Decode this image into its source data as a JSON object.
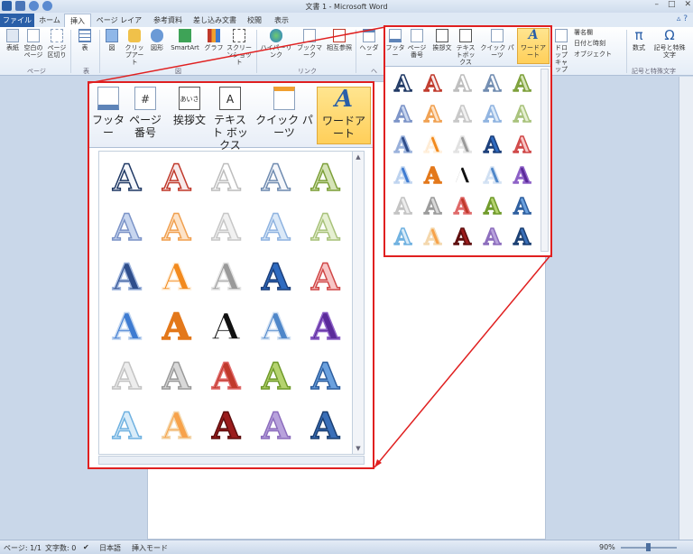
{
  "window": {
    "title": "文書 1 - Microsoft Word"
  },
  "tabs": [
    {
      "label": "ファイル"
    },
    {
      "label": "ホーム"
    },
    {
      "label": "挿入"
    },
    {
      "label": "ページ レイアウト"
    },
    {
      "label": "参考資料"
    },
    {
      "label": "差し込み文書"
    },
    {
      "label": "校閲"
    },
    {
      "label": "表示"
    }
  ],
  "ribbon": {
    "buttons": [
      {
        "label": "表紙"
      },
      {
        "label": "空白のページ"
      },
      {
        "label": "ページ区切り"
      },
      {
        "label": "表"
      },
      {
        "label": "図"
      },
      {
        "label": "クリップアート"
      },
      {
        "label": "図形"
      },
      {
        "label": "SmartArt"
      },
      {
        "label": "グラフ"
      },
      {
        "label": "スクリーンショット"
      },
      {
        "label": "ハイパーリンク"
      },
      {
        "label": "ブックマーク"
      },
      {
        "label": "相互参照"
      },
      {
        "label": "ヘッダー"
      },
      {
        "label": "フッター"
      },
      {
        "label": "ページ番号"
      },
      {
        "label": "挨拶文"
      },
      {
        "label": "テキストボックス"
      },
      {
        "label": "クイック パーツ"
      },
      {
        "label": "ワードアート"
      },
      {
        "label": "ドロップキャップ"
      },
      {
        "label": "署名欄"
      },
      {
        "label": "日付と時刻"
      },
      {
        "label": "オブジェクト"
      },
      {
        "label": "数式"
      },
      {
        "label": "記号と特殊文字"
      }
    ],
    "groups": [
      {
        "label": "ページ"
      },
      {
        "label": "表"
      },
      {
        "label": "図"
      },
      {
        "label": "リンク"
      },
      {
        "label": "ヘ"
      },
      {
        "label": "記号と特殊文字"
      }
    ]
  },
  "callout": {
    "buttons": [
      {
        "label": "フッター"
      },
      {
        "label": "ページ番号"
      },
      {
        "label": "挨拶文"
      },
      {
        "label": "テキスト ボックス"
      },
      {
        "label": "クイック パーツ"
      },
      {
        "label": "ワードアート"
      }
    ]
  },
  "gallery": {
    "letter": "A",
    "rows": [
      [
        {
          "c": "#f5f7fb",
          "s": "#1f3864"
        },
        {
          "c": "#f7eaea",
          "s": "#c0392b"
        },
        {
          "c": "#ffffff",
          "s": "#bdbdbd"
        },
        {
          "c": "#f5f7fb",
          "s": "#6f8bb0"
        },
        {
          "c": "#d6e4b8",
          "s": "#7da03a"
        }
      ],
      [
        {
          "c": "#c8d6ef",
          "s": "#7b93c7"
        },
        {
          "c": "#fde3c8",
          "s": "#f0a050"
        },
        {
          "c": "#f1f1f1",
          "s": "#c7c7c7"
        },
        {
          "c": "#dbe9f8",
          "s": "#8fb3e0"
        },
        {
          "c": "#e6f0d2",
          "s": "#a8c27b"
        }
      ],
      [
        {
          "c": "#2f4e8c",
          "s": "#9db4dd"
        },
        {
          "c": "#f28a1e",
          "s": "#fff0dd"
        },
        {
          "c": "#9a9a9a",
          "s": "#e4e4e4"
        },
        {
          "c": "#2f6bc0",
          "s": "#1c3f7a"
        },
        {
          "c": "#f7c6c6",
          "s": "#d04747"
        }
      ],
      [
        {
          "c": "#3e7bd1",
          "s": "#c2d6f0"
        },
        {
          "c": "#e3781b",
          "s": "#e3781b"
        },
        {
          "c": "#111111",
          "s": "#ffffff"
        },
        {
          "c": "#4f87c9",
          "s": "#d5e3f4"
        },
        {
          "c": "#5b2a9a",
          "s": "#8f63c8"
        }
      ],
      [
        {
          "c": "#ededed",
          "s": "#c3c3c3"
        },
        {
          "c": "#d9d9d9",
          "s": "#9a9a9a"
        },
        {
          "c": "#c0392b",
          "s": "#e06b6b"
        },
        {
          "c": "#b5d36f",
          "s": "#6f9a2a"
        },
        {
          "c": "#6ba1de",
          "s": "#2d5e9e"
        }
      ],
      [
        {
          "c": "#d9ecf9",
          "s": "#6fb1e0"
        },
        {
          "c": "#f7a24a",
          "s": "#f4d9b0"
        },
        {
          "c": "#9b1c1c",
          "s": "#5e0e0e"
        },
        {
          "c": "#b8a2dc",
          "s": "#8c6dbd"
        },
        {
          "c": "#3a6fb8",
          "s": "#1b3f72"
        }
      ]
    ]
  },
  "status": {
    "page": "ページ: 1/1",
    "words": "文字数: 0",
    "language": "日本語",
    "mode": "挿入モード",
    "zoom": "90%"
  }
}
